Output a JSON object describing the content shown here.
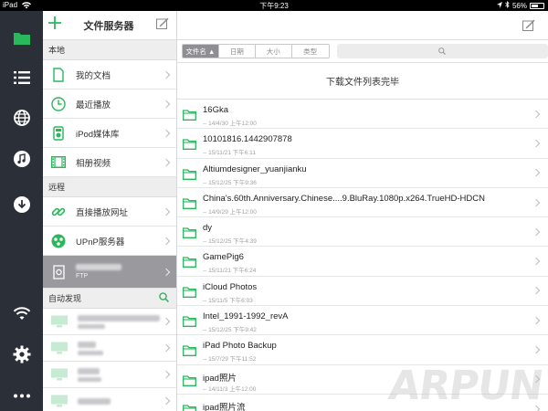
{
  "status_bar": {
    "device": "iPad",
    "wifi_icon": "wifi-icon",
    "time": "下午9:23",
    "battery": "56%"
  },
  "rail": {
    "items": [
      {
        "name": "files-tab",
        "icon": "folder-icon",
        "color": "#2bb75b"
      },
      {
        "name": "list-tab",
        "icon": "list-icon"
      },
      {
        "name": "browser-tab",
        "icon": "globe-icon"
      },
      {
        "name": "music-tab",
        "icon": "music-icon"
      },
      {
        "name": "download-tab",
        "icon": "download-icon"
      },
      {
        "name": "wifi-tab",
        "icon": "wifi-icon"
      },
      {
        "name": "settings-tab",
        "icon": "gear-icon"
      },
      {
        "name": "more-tab",
        "icon": "more-icon"
      }
    ]
  },
  "sidebar": {
    "title": "文件服务器",
    "local_header": "本地",
    "local_items": [
      {
        "label": "我的文档",
        "icon": "document-icon"
      },
      {
        "label": "最近播放",
        "icon": "clock-icon"
      },
      {
        "label": "iPod媒体库",
        "icon": "ipod-icon"
      },
      {
        "label": "相册视频",
        "icon": "film-icon"
      }
    ],
    "remote_header": "远程",
    "remote_items": [
      {
        "label": "直接播放网址",
        "icon": "link-icon"
      },
      {
        "label": "UPnP服务器",
        "icon": "upnp-icon"
      }
    ],
    "selected_server": {
      "subtitle": "FTP",
      "icon": "ftp-server-icon"
    },
    "auto_header": "自动发现",
    "auto_search_icon": "search-icon"
  },
  "main": {
    "sort_tabs": [
      "文件名 ▲",
      "日期",
      "大小",
      "类型"
    ],
    "active_sort": 0,
    "search_icon": "search-icon",
    "status": "下载文件列表完毕",
    "files": [
      {
        "name": "16Gka",
        "date": "-- 14/4/30 上午12:00"
      },
      {
        "name": "10101816.1442907878",
        "date": "-- 15/11/21 下午6:11"
      },
      {
        "name": "Altiumdesigner_yuanjianku",
        "date": "-- 15/12/25 下午9:36"
      },
      {
        "name": "China's.60th.Anniversary.Chinese....9.BluRay.1080p.x264.TrueHD-HDCN",
        "date": "-- 14/9/29 上午12:00"
      },
      {
        "name": "dy",
        "date": "-- 15/12/25 下午4:39"
      },
      {
        "name": "GamePig6",
        "date": "-- 15/11/21 下午6:24"
      },
      {
        "name": "iCloud Photos",
        "date": "-- 15/11/5 下午6:03"
      },
      {
        "name": "Intel_1991-1992_revA",
        "date": "-- 15/12/25 下午9:42"
      },
      {
        "name": "iPad Photo Backup",
        "date": "-- 15/7/29 下午11:52"
      },
      {
        "name": "ipad照片",
        "date": "-- 14/11/3 上午12:00"
      },
      {
        "name": "ipad照片流",
        "date": "-- 14/11/3 上午12:00"
      }
    ]
  },
  "watermark": "ARPUN",
  "colors": {
    "accent": "#2bb75b",
    "rail_bg": "#2b2f38",
    "selected_bg": "#9a9a9e"
  }
}
